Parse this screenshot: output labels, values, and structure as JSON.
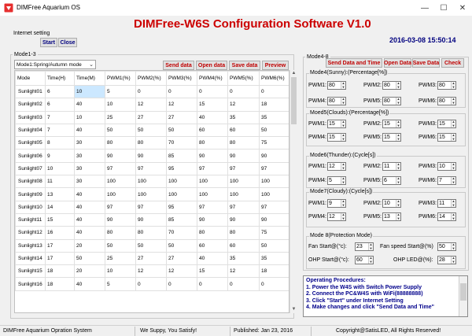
{
  "window": {
    "title": "DIMFree Aquarium OS",
    "minimize_glyph": "—",
    "maximize_glyph": "☐",
    "close_glyph": "✕"
  },
  "header": {
    "app_title": "DIMFree-W6S Configuration Software V1.0",
    "datetime": "2016-03-08 15:50:14"
  },
  "internet": {
    "label": "Internet setting",
    "start_label": "Start",
    "close_label": "Close"
  },
  "mode13": {
    "group_label": "Mode1-3",
    "mode_select": "Mode1:Spring/Autumn mode",
    "send_label": "Send data",
    "open_label": "Open data",
    "save_label": "Save data",
    "preview_label": "Preview",
    "columns": [
      "Mode",
      "Time(H)",
      "Time(M)",
      "PWM1(%)",
      "PWM2(%)",
      "PWM3(%)",
      "PWM4(%)",
      "PWM5(%)",
      "PWM6(%)"
    ],
    "rows": [
      [
        "Sunlight01",
        "6",
        "10",
        "5",
        "0",
        "0",
        "0",
        "0",
        "0"
      ],
      [
        "Sunlight02",
        "6",
        "40",
        "10",
        "12",
        "12",
        "15",
        "12",
        "18"
      ],
      [
        "Sunlight03",
        "7",
        "10",
        "25",
        "27",
        "27",
        "40",
        "35",
        "35"
      ],
      [
        "Sunlight04",
        "7",
        "40",
        "50",
        "50",
        "50",
        "60",
        "60",
        "50"
      ],
      [
        "Sunlight05",
        "8",
        "30",
        "80",
        "80",
        "70",
        "80",
        "80",
        "75"
      ],
      [
        "Sunlight06",
        "9",
        "30",
        "90",
        "90",
        "85",
        "90",
        "90",
        "90"
      ],
      [
        "Sunlight07",
        "10",
        "30",
        "97",
        "97",
        "95",
        "97",
        "97",
        "97"
      ],
      [
        "Sunlight08",
        "11",
        "30",
        "100",
        "100",
        "100",
        "100",
        "100",
        "100"
      ],
      [
        "Sunlight09",
        "13",
        "40",
        "100",
        "100",
        "100",
        "100",
        "100",
        "100"
      ],
      [
        "Sunlight10",
        "14",
        "40",
        "97",
        "97",
        "95",
        "97",
        "97",
        "97"
      ],
      [
        "Sunlight11",
        "15",
        "40",
        "90",
        "90",
        "85",
        "90",
        "90",
        "90"
      ],
      [
        "Sunlight12",
        "16",
        "40",
        "80",
        "80",
        "70",
        "80",
        "80",
        "75"
      ],
      [
        "Sunlight13",
        "17",
        "20",
        "50",
        "50",
        "50",
        "60",
        "60",
        "50"
      ],
      [
        "Sunlight14",
        "17",
        "50",
        "25",
        "27",
        "27",
        "40",
        "35",
        "35"
      ],
      [
        "Sunlight15",
        "18",
        "20",
        "10",
        "12",
        "12",
        "15",
        "12",
        "18"
      ],
      [
        "Sunlight16",
        "18",
        "40",
        "5",
        "0",
        "0",
        "0",
        "0",
        "0"
      ]
    ]
  },
  "mode48": {
    "group_label": "Mode4-8",
    "send_time_label": "Send Data and Time",
    "open_label": "Open Data",
    "save_label": "Save Data",
    "check_label": "Check",
    "mode4": {
      "title": "Mode4(Sunny):(Percentage[%])",
      "fields": [
        {
          "label": "PWM1:",
          "value": "80"
        },
        {
          "label": "PWM2:",
          "value": "80"
        },
        {
          "label": "PWM3:",
          "value": "80"
        },
        {
          "label": "PWM4:",
          "value": "80"
        },
        {
          "label": "PWM5:",
          "value": "80"
        },
        {
          "label": "PWM6:",
          "value": "80"
        }
      ]
    },
    "mode5": {
      "title": "Moed5(Clouds):(Percentage[%])",
      "fields": [
        {
          "label": "PWM1:",
          "value": "15"
        },
        {
          "label": "PWM2:",
          "value": "15"
        },
        {
          "label": "PWM3:",
          "value": "15"
        },
        {
          "label": "PWM4:",
          "value": "15"
        },
        {
          "label": "PWM5:",
          "value": "15"
        },
        {
          "label": "PWM6:",
          "value": "15"
        }
      ]
    },
    "mode6": {
      "title": "Mode6(Thunder):(Cycle[s])",
      "fields": [
        {
          "label": "PWM1:",
          "value": "12"
        },
        {
          "label": "PWM2:",
          "value": "11"
        },
        {
          "label": "PWM3:",
          "value": "10"
        },
        {
          "label": "PWM4:",
          "value": "5"
        },
        {
          "label": "PWM5:",
          "value": "6"
        },
        {
          "label": "PWM6:",
          "value": "7"
        }
      ]
    },
    "mode7": {
      "title": "Mode7(Cloudy):(Cycle[s])",
      "fields": [
        {
          "label": "PWM1:",
          "value": "9"
        },
        {
          "label": "PWM2:",
          "value": "10"
        },
        {
          "label": "PWM3:",
          "value": "11"
        },
        {
          "label": "PWM4:",
          "value": "12"
        },
        {
          "label": "PWM5:",
          "value": "13"
        },
        {
          "label": "PWM6:",
          "value": "14"
        }
      ]
    },
    "mode8": {
      "title": "Mode 8(Protection Mode)",
      "fan_start_label": "Fan Start@(°c):",
      "fan_start_value": "23",
      "fan_speed_label": "Fan speed Start@(%)",
      "fan_speed_value": "50",
      "ohp_start_label": "OHP Start@(°c):",
      "ohp_start_value": "60",
      "ohp_led_label": "OHP LED@(%):",
      "ohp_led_value": "28"
    }
  },
  "procedures": {
    "title": "Operating Procedures:",
    "steps": [
      "1. Power the W4S with Switch Power Supply",
      "2. Connect the PC&W4S with WiFi(88888888)",
      "3. Click \"Start\" under Internet Setting",
      "4. Make changes and click \"Send Data and Time\""
    ]
  },
  "statusbar": {
    "system": "DIMFree Aquarium Opration System",
    "slogan": "We Suppy, You Satisfy!",
    "published": "Published: Jan 23, 2016",
    "copyright": "Copyright@SatisLED, All Rights Reserved!"
  },
  "colors": {
    "title_red": "#cc0000",
    "clock_blue": "#00007f",
    "procedure_blue": "#00008b",
    "selected_cell": "#cce8ff"
  },
  "icons": {
    "app": "aquarium-app-icon",
    "select_arrow": "chevron-down-icon",
    "spin": "spin-arrows-icon"
  }
}
